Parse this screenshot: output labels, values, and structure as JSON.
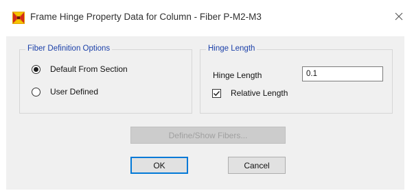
{
  "window": {
    "title": "Frame Hinge Property Data for Column - Fiber P-M2-M3",
    "app_icon": "etabs-logo-icon",
    "close_icon": "close-icon"
  },
  "fiber_definition": {
    "group_title": "Fiber Definition Options",
    "options": [
      {
        "label": "Default From Section",
        "selected": true
      },
      {
        "label": "User Defined",
        "selected": false
      }
    ]
  },
  "hinge_length": {
    "group_title": "Hinge Length",
    "field_label": "Hinge Length",
    "value": "0.1",
    "relative_label": "Relative Length",
    "relative_checked": true
  },
  "buttons": {
    "define_fibers": "Define/Show Fibers...",
    "define_fibers_enabled": false,
    "ok": "OK",
    "cancel": "Cancel"
  },
  "colors": {
    "group_title": "#1a3fa8",
    "dialog_bg": "#f0f0f0",
    "default_button_border": "#0078d7"
  }
}
